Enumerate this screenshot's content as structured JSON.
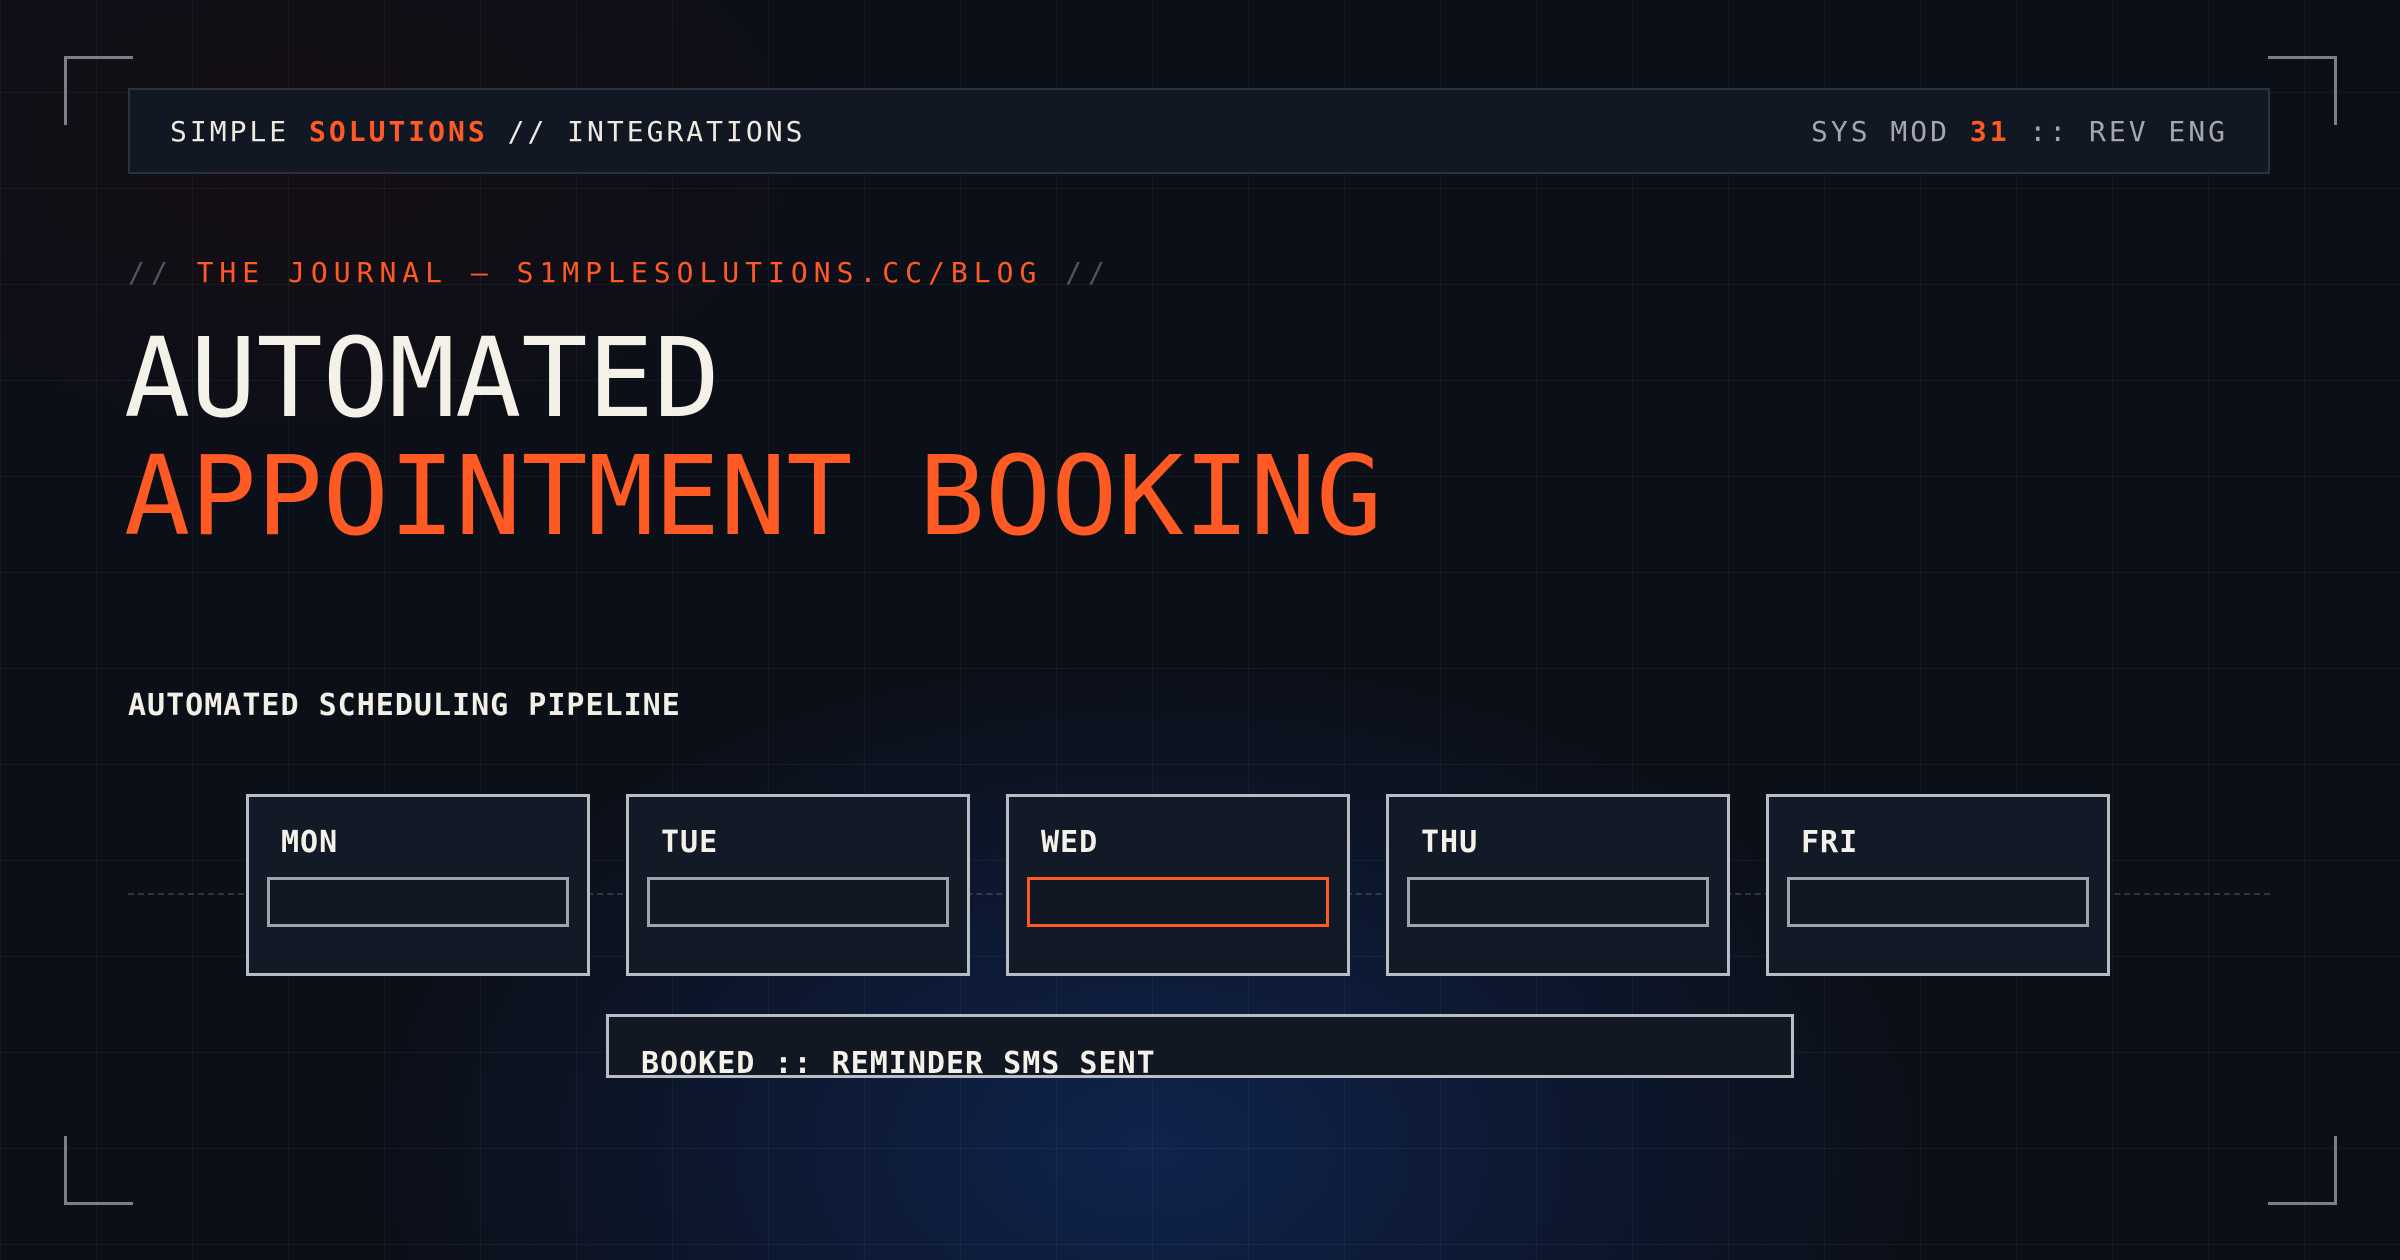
{
  "header": {
    "brand_word1": "SIMPLE ",
    "brand_word2": "SOLUTIONS",
    "brand_suffix": " // INTEGRATIONS",
    "sys_prefix": "SYS MOD ",
    "sys_number": "31",
    "sys_suffix": " :: REV ENG"
  },
  "kicker": {
    "open": "// ",
    "text": "THE JOURNAL — S1MPLESOLUTIONS.CC/BLOG",
    "close": " //"
  },
  "title": {
    "line1": "AUTOMATED",
    "line2": "APPOINTMENT BOOKING"
  },
  "pipeline": {
    "label": "AUTOMATED SCHEDULING PIPELINE",
    "days": [
      {
        "name": "MON",
        "active": false
      },
      {
        "name": "TUE",
        "active": false
      },
      {
        "name": "WED",
        "active": true
      },
      {
        "name": "THU",
        "active": false
      },
      {
        "name": "FRI",
        "active": false
      }
    ],
    "status": "BOOKED :: REMINDER SMS SENT"
  },
  "colors": {
    "accent": "#ff5a24",
    "background": "#0b0f18",
    "text": "#f4f1e8"
  }
}
